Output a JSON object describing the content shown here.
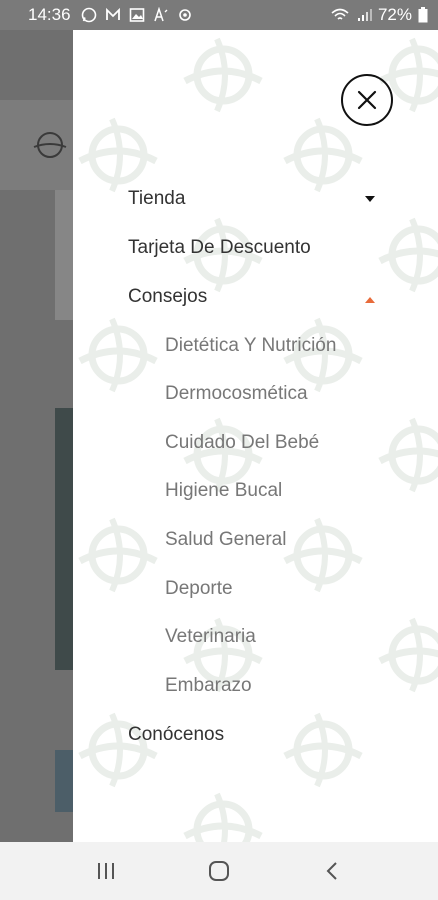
{
  "status_bar": {
    "time": "14:36",
    "notification_icons": [
      "whatsapp-icon",
      "gmail-icon",
      "gallery-icon",
      "text-size-icon",
      "settings-icon"
    ],
    "battery": "72%"
  },
  "drawer": {
    "menu": [
      {
        "label": "Tienda",
        "caret": "down"
      },
      {
        "label": "Tarjeta De Descuento"
      },
      {
        "label": "Consejos",
        "caret": "up"
      },
      {
        "label": "Conócenos"
      }
    ],
    "submenu_consejos": [
      "Dietética Y Nutrición",
      "Dermocosmética",
      "Cuidado Del Bebé",
      "Higiene Bucal",
      "Salud General",
      "Deporte",
      "Veterinaria",
      "Embarazo"
    ]
  },
  "colors": {
    "caret_down": "#111111",
    "caret_up": "#e86b3a",
    "watermark": "#eef1ee"
  }
}
